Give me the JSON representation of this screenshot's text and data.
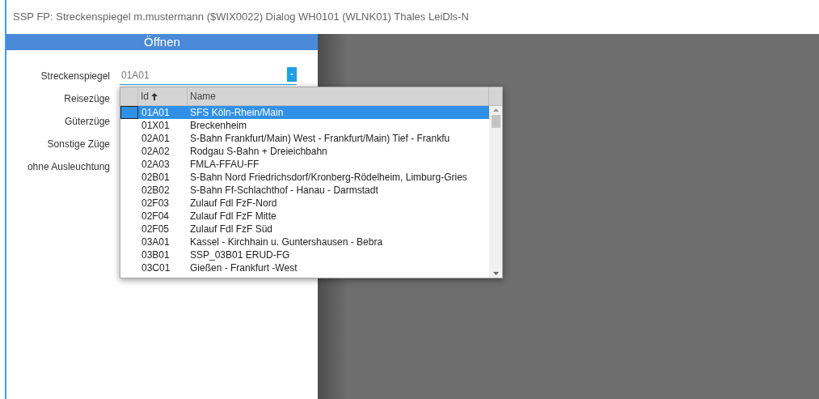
{
  "window": {
    "title": "SSP FP: Streckenspiegel m.mustermann ($WIX0022) Dialog WH0101 (WLNK01) Thales LeiDls-N"
  },
  "dialog": {
    "title": "Öffnen",
    "fields": [
      {
        "label": "Streckenspiegel",
        "value": "01A01"
      },
      {
        "label": "Reisezüge"
      },
      {
        "label": "Güterzüge"
      },
      {
        "label": "Sonstige Züge"
      },
      {
        "label": "ohne Ausleuchtung"
      }
    ]
  },
  "dropdown": {
    "columns": [
      {
        "label": "Id",
        "sorted": true
      },
      {
        "label": "Name",
        "sorted": false
      }
    ],
    "rows": [
      {
        "id": "01A01",
        "name": "SFS Köln-Rhein/Main",
        "selected": true
      },
      {
        "id": "01X01",
        "name": "Breckenheim",
        "selected": false
      },
      {
        "id": "02A01",
        "name": "S-Bahn Frankfurt/Main) West - Frankfurt/Main) Tief - Frankfu",
        "selected": false
      },
      {
        "id": "02A02",
        "name": "Rodgau S-Bahn + Dreieichbahn",
        "selected": false
      },
      {
        "id": "02A03",
        "name": "FMLA-FFAU-FF",
        "selected": false
      },
      {
        "id": "02B01",
        "name": "S-Bahn Nord Friedrichsdorf/Kronberg-Rödelheim, Limburg-Gries",
        "selected": false
      },
      {
        "id": "02B02",
        "name": "S-Bahn Ff-Schlachthof - Hanau - Darmstadt",
        "selected": false
      },
      {
        "id": "02F03",
        "name": "Zulauf Fdl FzF-Nord",
        "selected": false
      },
      {
        "id": "02F04",
        "name": "Zulauf Fdl FzF Mitte",
        "selected": false
      },
      {
        "id": "02F05",
        "name": "Zulauf Fdl FzF Süd",
        "selected": false
      },
      {
        "id": "03A01",
        "name": "Kassel - Kirchhain u. Guntershausen - Bebra",
        "selected": false
      },
      {
        "id": "03B01",
        "name": "SSP_03B01 ERUD-FG",
        "selected": false
      },
      {
        "id": "03C01",
        "name": "Gießen - Frankfurt -West",
        "selected": false
      }
    ]
  }
}
